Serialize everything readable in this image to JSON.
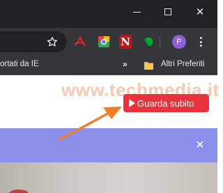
{
  "window": {
    "minimize_icon": "minimize-icon",
    "maximize_icon": "maximize-icon",
    "close_glyph": "✕"
  },
  "toolbar": {
    "star_icon": "bookmark-star-icon",
    "extensions": [
      {
        "name": "pdf-icon"
      },
      {
        "name": "chrome-extension-icon"
      },
      {
        "name": "n-extension-icon",
        "label": "N"
      },
      {
        "name": "evernote-icon"
      }
    ],
    "profile_initial": "P",
    "menu_icon": "three-dots-menu-icon"
  },
  "bookmarks": {
    "imported_label": "ortati da IE",
    "overflow_glyph": "»",
    "other_label": "Altri Preferiti"
  },
  "page": {
    "watermark": "www.techmedia.it",
    "watch_button": "Guarda subito",
    "banner_close": "✕"
  },
  "colors": {
    "titlebar": "#202124",
    "toolbar": "#35363a",
    "watch_button": "#e8323c",
    "banner": "#8c8fea",
    "arrow": "#f07f2a"
  }
}
